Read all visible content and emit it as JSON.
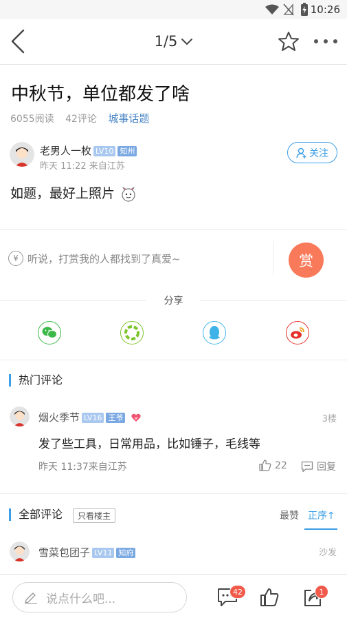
{
  "status_bar": {
    "time": "10:26"
  },
  "nav": {
    "page_indicator": "1/5"
  },
  "post": {
    "title": "中秋节，单位都发了啥",
    "reads": "6055阅读",
    "comments": "42评论",
    "topic": "城事话题",
    "author": {
      "name": "老男人一枚",
      "level": "LV10",
      "role": "知州",
      "time": "昨天 11:22  来自江苏"
    },
    "follow_label": "关注",
    "body": "如题，最好上照片"
  },
  "reward": {
    "yen": "¥",
    "prompt": "听说，打赏我的人都找到了真爱~",
    "button": "赏"
  },
  "share": {
    "label": "分享",
    "items": [
      "wechat-icon",
      "moments-icon",
      "qq-icon",
      "weibo-icon"
    ]
  },
  "hot_comments": {
    "title": "热门评论",
    "items": [
      {
        "name": "烟火季节",
        "level": "LV16",
        "role": "王爷",
        "floor": "3楼",
        "text": "发了些工具，日常用品，比如锤子，毛线等",
        "time": "昨天 11:37来自江苏",
        "likes": "22",
        "reply_label": "回复"
      }
    ]
  },
  "all_comments": {
    "title": "全部评论",
    "only_host": "只看楼主",
    "sort_hot": "最赞",
    "sort_order": "正序↑",
    "items": [
      {
        "name": "雪菜包团子",
        "level": "LV11",
        "role": "知府",
        "floor": "沙发"
      }
    ]
  },
  "bottom_bar": {
    "placeholder": "说点什么吧...",
    "comment_count": "42",
    "share_count": "1"
  },
  "colors": {
    "accent": "#3a9ee6",
    "reward": "#f97a5a",
    "badge": "#f15a4a"
  }
}
